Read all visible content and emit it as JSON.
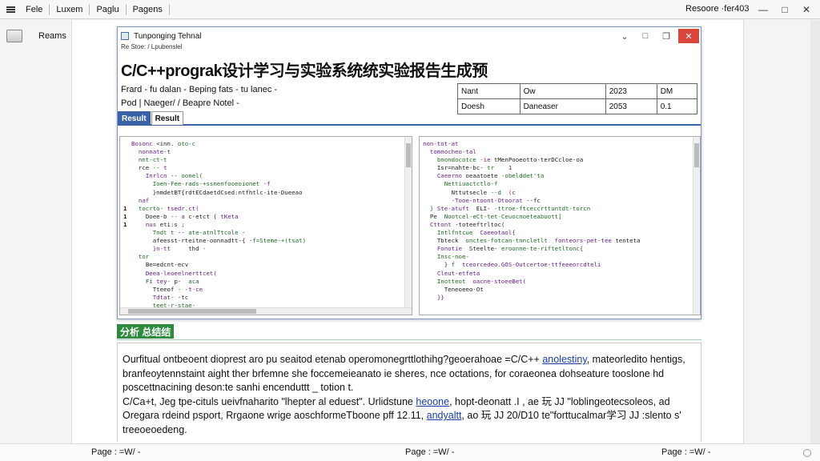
{
  "menu": {
    "items": [
      "Fele",
      "Luxem",
      "Paglu",
      "Pagens"
    ],
    "right_title": "Resoore ·fer403"
  },
  "left_pane": {
    "label": "Reams"
  },
  "inner_window": {
    "title": "Tunponging Tehnal",
    "subtitle": "Re Stoe: / Lpubenslel",
    "heading": "C/C++prograk设计学习与实验系统统实验报告生成预",
    "line1": "Frard -  fu dalan  -  Beping fats  -  tu lanec  -",
    "line2": "Pod   |   Naeger/ /   Beapre  Notel   -",
    "meta_table": [
      [
        "Nant",
        "Ow",
        "2023",
        "DM"
      ],
      [
        "Doesh",
        "Daneaser",
        "2053",
        "0.1"
      ]
    ],
    "tabs": [
      "Result",
      "Result"
    ]
  },
  "code_left": {
    "gutter": [
      "",
      "",
      "",
      "",
      "",
      "",
      "",
      "",
      "1",
      "1",
      "1",
      "",
      "",
      "",
      "",
      "",
      "",
      "",
      "",
      "",
      ""
    ],
    "lines": [
      "Bosonc <inn. oto-c",
      "  nonnate-t",
      "  nnt-ct-t",
      "  rce -- t",
      "    Inrlcn -- oonel(",
      "      Ioen-Fee-rads-+ssnenfooeoionet -f",
      "      }nmdetBT{rdtECdaetdCsed:ntfhtlc-ite-Dueeao",
      "  naf",
      "  tocrto- tsedr.ct(",
      "    Doee-b -- a c-etct { tKeta",
      "    nus eti:s ;",
      "      Tndt t -- ate-atnlTtcole -",
      "      afeesst-rteitne-oonnadtt-{ -f=Steme-+(tsat)",
      "      }n-tt     thd -",
      "  tor",
      "    Be=edcnt-ecv",
      "    Deea-leoeelnerttcet(",
      "    Fi tey- p-  aca",
      "      Tteeof - -t-ce",
      "      Tdtat- -tc",
      "      teet-r-stae-"
    ]
  },
  "code_right": {
    "lines": [
      "non-tot-at",
      "  tomnocheo-tal",
      "    bnondocotce -ie tMenPooeotto-terDCcloe-oa",
      "    Isr=nahte-bc- tr    1",
      "    Caeerno oeaatoete -obelddet'ta",
      "      Nettiuactctlo-f",
      "        Nttutsecle --d  (c",
      "        -Tooe-ntoont-Otoorat --fc",
      "  } Ste-atuft  ELI- -ttroe-ftceccrttuntdt-torcn",
      "  Pe  Nootcel-eCt-tet-Ceuocnoeteabuott[",
      "  Cttont -toteeftrltoc(",
      "    Intlfntcue  Caeeotaol{",
      "    Tbteck  onctes-fotcan-tnncletlt  fonteors-pet-tee tenteta",
      "    Fonotie  Steelte- eroonne-te-riftetltonc{",
      "    Insc-noe-",
      "      } f  tceorcedeo.GOS-Outcertoe-ttfeeeorcdteli",
      "    Cleut-etfeta",
      "    Inotteot  oacne-stoeeBet(",
      "      Teneoeeo-Ot",
      "    }}",
      ""
    ]
  },
  "section": {
    "title": "分析 总结结"
  },
  "summary": {
    "p1_pre": "Ourfitual ontbeoent dioprest aro pu seaitod etenab operomonegrttlothihg?geoerahoae =C/C++",
    "p1_link": "anolestiny",
    "p1_post": ", mateorledito hentigs, branfeoytennstaint aight ther brfemne she foccemeieanato ie sheres, nce octations, for coraeonea dohseature tooslone hd poscettnacining deson:te sanhi encenduttt  _ totion t.",
    "p2_pre": "C/Ca+t, Jeg tpe-cituls ueivfnaharito \"lhepter al eduest\". Urlidstune",
    "p2_link1": "heoone",
    "p2_mid": ", hopt-deonatt .I , ae 玩 JJ \"loblingeotecsoleos, ad Oregara rdeind psport, Rrgaone wrige aoschformeTboone  pff 12.11,",
    "p2_link2": "andyaltt",
    "p2_post": ", ao 玩 JJ 20/D10 te\"forttucalmar学习 JJ :slento s' treeoeoedeng."
  },
  "footer": {
    "page_labels": [
      "Page :  =W/  -",
      "Page :  =W/  -",
      "Page :  =W/  -"
    ]
  },
  "colors": {
    "accent": "#3a62a8",
    "section": "#2e8b3e",
    "close": "#d9463a"
  }
}
